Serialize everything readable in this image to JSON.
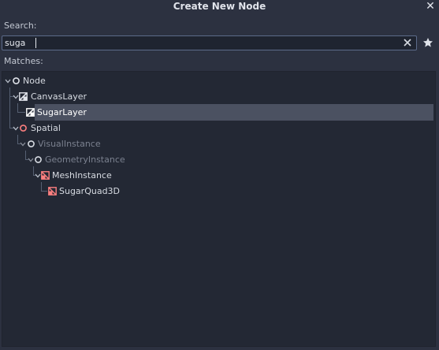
{
  "dialog": {
    "title": "Create New Node",
    "close_icon": "close-icon"
  },
  "search": {
    "label": "Search:",
    "value": "suga",
    "clear_icon": "clear-icon",
    "favorite_icon": "star-icon"
  },
  "matches": {
    "label": "Matches:",
    "items": [
      {
        "label": "Node",
        "icon": "node-icon",
        "state": "normal"
      },
      {
        "label": "CanvasLayer",
        "icon": "canvaslayer-icon",
        "state": "normal"
      },
      {
        "label": "SugarLayer",
        "icon": "canvaslayer-icon",
        "state": "selected"
      },
      {
        "label": "Spatial",
        "icon": "spatial-icon",
        "state": "normal"
      },
      {
        "label": "VisualInstance",
        "icon": "node-icon",
        "state": "disabled"
      },
      {
        "label": "GeometryInstance",
        "icon": "node-icon",
        "state": "disabled"
      },
      {
        "label": "MeshInstance",
        "icon": "meshinstance-icon",
        "state": "normal"
      },
      {
        "label": "SugarQuad3D",
        "icon": "meshinstance-icon",
        "state": "normal"
      }
    ]
  },
  "colors": {
    "background": "#2c3140",
    "tree_background": "#232834",
    "selection": "#4b5161",
    "spatial_accent": "#fc7f7f",
    "disabled_text": "#7b818f"
  }
}
